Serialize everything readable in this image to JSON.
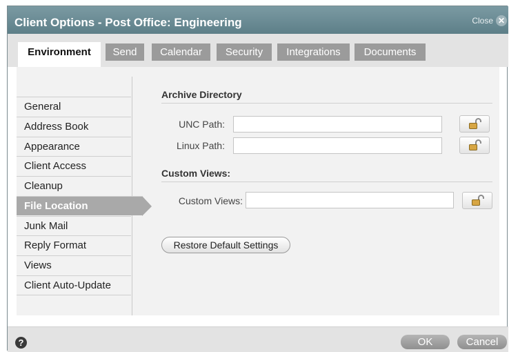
{
  "dialog": {
    "title": "Client Options - Post Office: Engineering",
    "close_label": "Close",
    "close_glyph": "✕"
  },
  "tabs": [
    {
      "label": "Environment",
      "active": true
    },
    {
      "label": "Send",
      "active": false
    },
    {
      "label": "Calendar",
      "active": false
    },
    {
      "label": "Security",
      "active": false
    },
    {
      "label": "Integrations",
      "active": false
    },
    {
      "label": "Documents",
      "active": false
    }
  ],
  "sidebar": {
    "items": [
      {
        "label": "General"
      },
      {
        "label": "Address Book"
      },
      {
        "label": "Appearance"
      },
      {
        "label": "Client Access"
      },
      {
        "label": "Cleanup"
      },
      {
        "label": "File Location",
        "active": true
      },
      {
        "label": "Junk Mail"
      },
      {
        "label": "Reply Format"
      },
      {
        "label": "Views"
      },
      {
        "label": "Client Auto-Update"
      }
    ]
  },
  "archive": {
    "title": "Archive Directory",
    "unc_label": "UNC Path:",
    "unc_value": "",
    "linux_label": "Linux Path:",
    "linux_value": ""
  },
  "custom_views": {
    "title": "Custom Views:",
    "label": "Custom Views:",
    "value": ""
  },
  "restore_label": "Restore Default Settings",
  "footer": {
    "help_glyph": "?",
    "ok_label": "OK",
    "cancel_label": "Cancel"
  },
  "icons": {
    "lock": "lock-open-icon",
    "help": "help-icon",
    "close": "close-icon"
  },
  "colors": {
    "titlebar": "#6a8b94",
    "lock_shackle": "#c89a3c"
  }
}
